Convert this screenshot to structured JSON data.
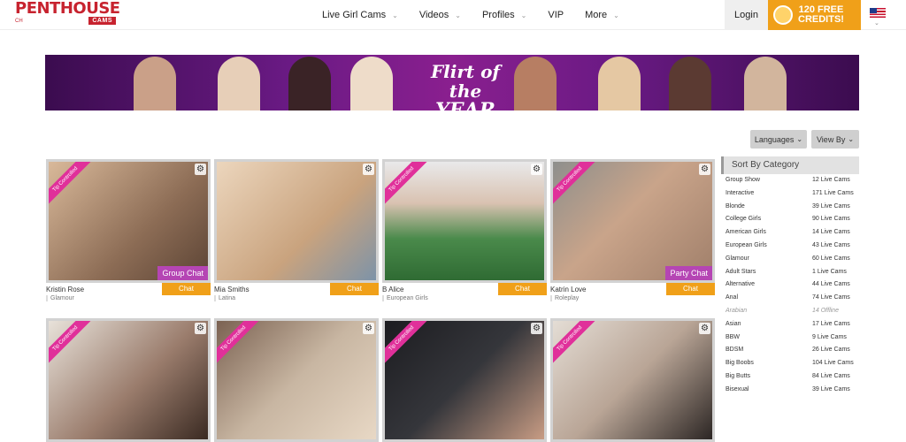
{
  "header": {
    "logo": {
      "main": "PENTHOUSE",
      "sub": "CAMS",
      "tiny": "CH"
    },
    "nav": [
      {
        "label": "Live Girl Cams",
        "has_dropdown": true
      },
      {
        "label": "Videos",
        "has_dropdown": true
      },
      {
        "label": "Profiles",
        "has_dropdown": true
      },
      {
        "label": "VIP",
        "has_dropdown": false
      },
      {
        "label": "More",
        "has_dropdown": true
      }
    ],
    "login_label": "Login",
    "credits": {
      "line1": "120 FREE",
      "line2": "CREDITS!"
    },
    "flag_icon": "us-flag-icon"
  },
  "banner": {
    "line1": "Flirt of the",
    "line2": "YEAR"
  },
  "filters": {
    "languages_label": "Languages",
    "view_by_label": "View By"
  },
  "cards": [
    {
      "name": "Kristin Rose",
      "category": "Glamour",
      "chat_label": "Chat",
      "tip": "Tip Controlled",
      "badge": "Group Chat",
      "color": "#8c6c55"
    },
    {
      "name": "Mia Smiths",
      "category": "Latina",
      "chat_label": "Chat",
      "tip": "",
      "badge": "",
      "color": "#c9a37e"
    },
    {
      "name": "B Alice",
      "category": "European Girls",
      "chat_label": "Chat",
      "tip": "Tip Controlled",
      "badge": "",
      "color": "#4a8a4b"
    },
    {
      "name": "Katrin Love",
      "category": "Roleplay",
      "chat_label": "Chat",
      "tip": "Tip Controlled",
      "badge": "Party Chat",
      "color": "#a07f6a"
    },
    {
      "name": "",
      "category": "",
      "chat_label": "",
      "tip": "Tip Controlled",
      "badge": "",
      "color": "#9a7c6c"
    },
    {
      "name": "",
      "category": "",
      "chat_label": "",
      "tip": "Tip Controlled",
      "badge": "",
      "color": "#c8b6a2"
    },
    {
      "name": "",
      "category": "",
      "chat_label": "",
      "tip": "Tip Controlled",
      "badge": "",
      "color": "#35363b"
    },
    {
      "name": "",
      "category": "",
      "chat_label": "",
      "tip": "Tip Controlled",
      "badge": "",
      "color": "#b9a596"
    }
  ],
  "sidebar": {
    "title": "Sort By Category",
    "rows": [
      {
        "name": "Group Show",
        "count": "12 Live Cams"
      },
      {
        "name": "Interactive",
        "count": "171 Live Cams"
      },
      {
        "name": "Blonde",
        "count": "39 Live Cams"
      },
      {
        "name": "College Girls",
        "count": "90 Live Cams"
      },
      {
        "name": "American Girls",
        "count": "14 Live Cams"
      },
      {
        "name": "European Girls",
        "count": "43 Live Cams"
      },
      {
        "name": "Glamour",
        "count": "60 Live Cams"
      },
      {
        "name": "Adult Stars",
        "count": "1 Live Cams"
      },
      {
        "name": "Alternative",
        "count": "44 Live Cams"
      },
      {
        "name": "Anal",
        "count": "74 Live Cams"
      },
      {
        "name": "Arabian",
        "count": "14 Offline"
      },
      {
        "name": "Asian",
        "count": "17 Live Cams"
      },
      {
        "name": "BBW",
        "count": "9 Live Cams"
      },
      {
        "name": "BDSM",
        "count": "26 Live Cams"
      },
      {
        "name": "Big Boobs",
        "count": "104 Live Cams"
      },
      {
        "name": "Big Butts",
        "count": "84 Live Cams"
      },
      {
        "name": "Bisexual",
        "count": "39 Live Cams"
      }
    ]
  }
}
